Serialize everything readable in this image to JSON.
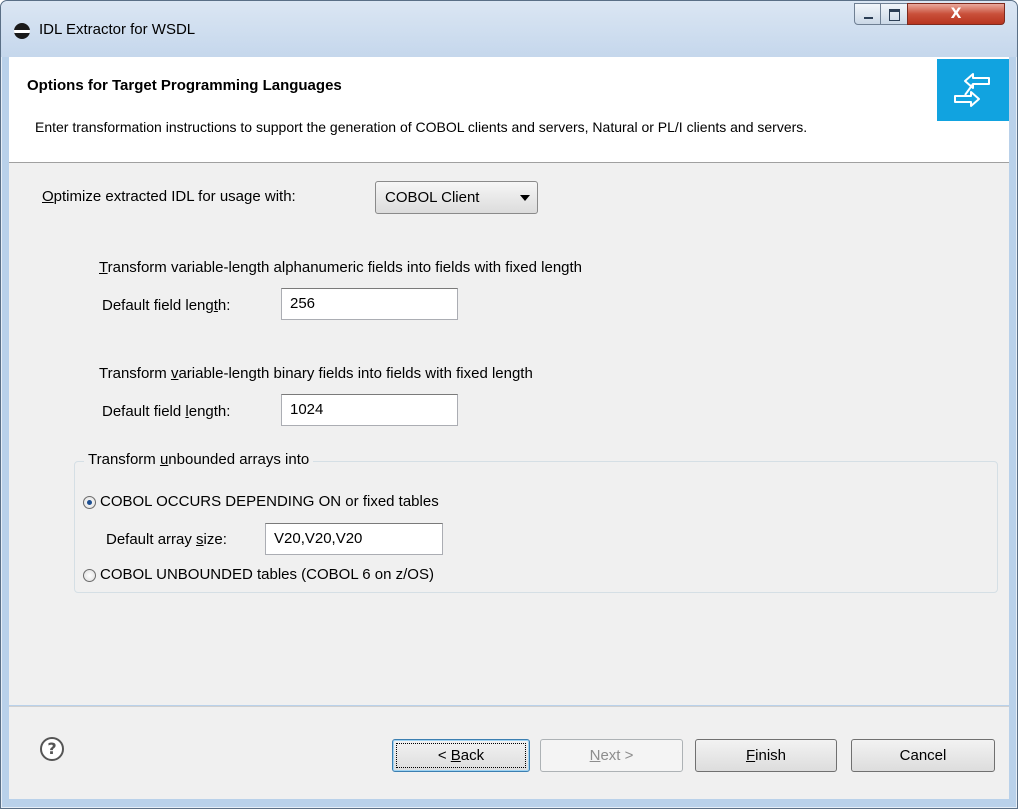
{
  "window": {
    "title": "IDL Extractor for WSDL",
    "close_glyph": "X"
  },
  "banner": {
    "title": "Options for Target Programming Languages",
    "description": "Enter transformation instructions to support the generation of COBOL clients and servers, Natural or PL/I clients and servers.",
    "icon": "transfer-arrows-icon",
    "icon_bg": "#11a3e0"
  },
  "optimize": {
    "label_mn": "O",
    "label_rest": "ptimize extracted IDL for usage with:",
    "selected": "COBOL Client"
  },
  "alnum": {
    "heading_mn": "T",
    "heading_rest": "ransform variable-length alphanumeric fields into fields with fixed length",
    "field_label_pre": "Default field leng",
    "field_label_mn": "t",
    "field_label_post": "h:",
    "value": "256"
  },
  "binary": {
    "heading_pre": "Transform ",
    "heading_mn": "v",
    "heading_rest": "ariable-length binary fields into fields with fixed length",
    "field_label_pre": "Default field ",
    "field_label_mn": "l",
    "field_label_post": "ength:",
    "value": "1024"
  },
  "arrays": {
    "legend_pre": "Transform ",
    "legend_mn": "u",
    "legend_rest": "nbounded arrays into",
    "option1": "COBOL OCCURS DEPENDING ON or fixed tables",
    "option1_checked": true,
    "size_label_pre": "Default array ",
    "size_label_mn": "s",
    "size_label_post": "ize:",
    "size_value": "V20,V20,V20",
    "option2": "COBOL UNBOUNDED tables (COBOL 6 on z/OS)",
    "option2_checked": false
  },
  "footer": {
    "help_glyph": "?",
    "back_pre": "< ",
    "back_mn": "B",
    "back_rest": "ack",
    "next_mn": "N",
    "next_rest": "ext >",
    "finish_mn": "F",
    "finish_rest": "inish",
    "cancel": "Cancel"
  }
}
